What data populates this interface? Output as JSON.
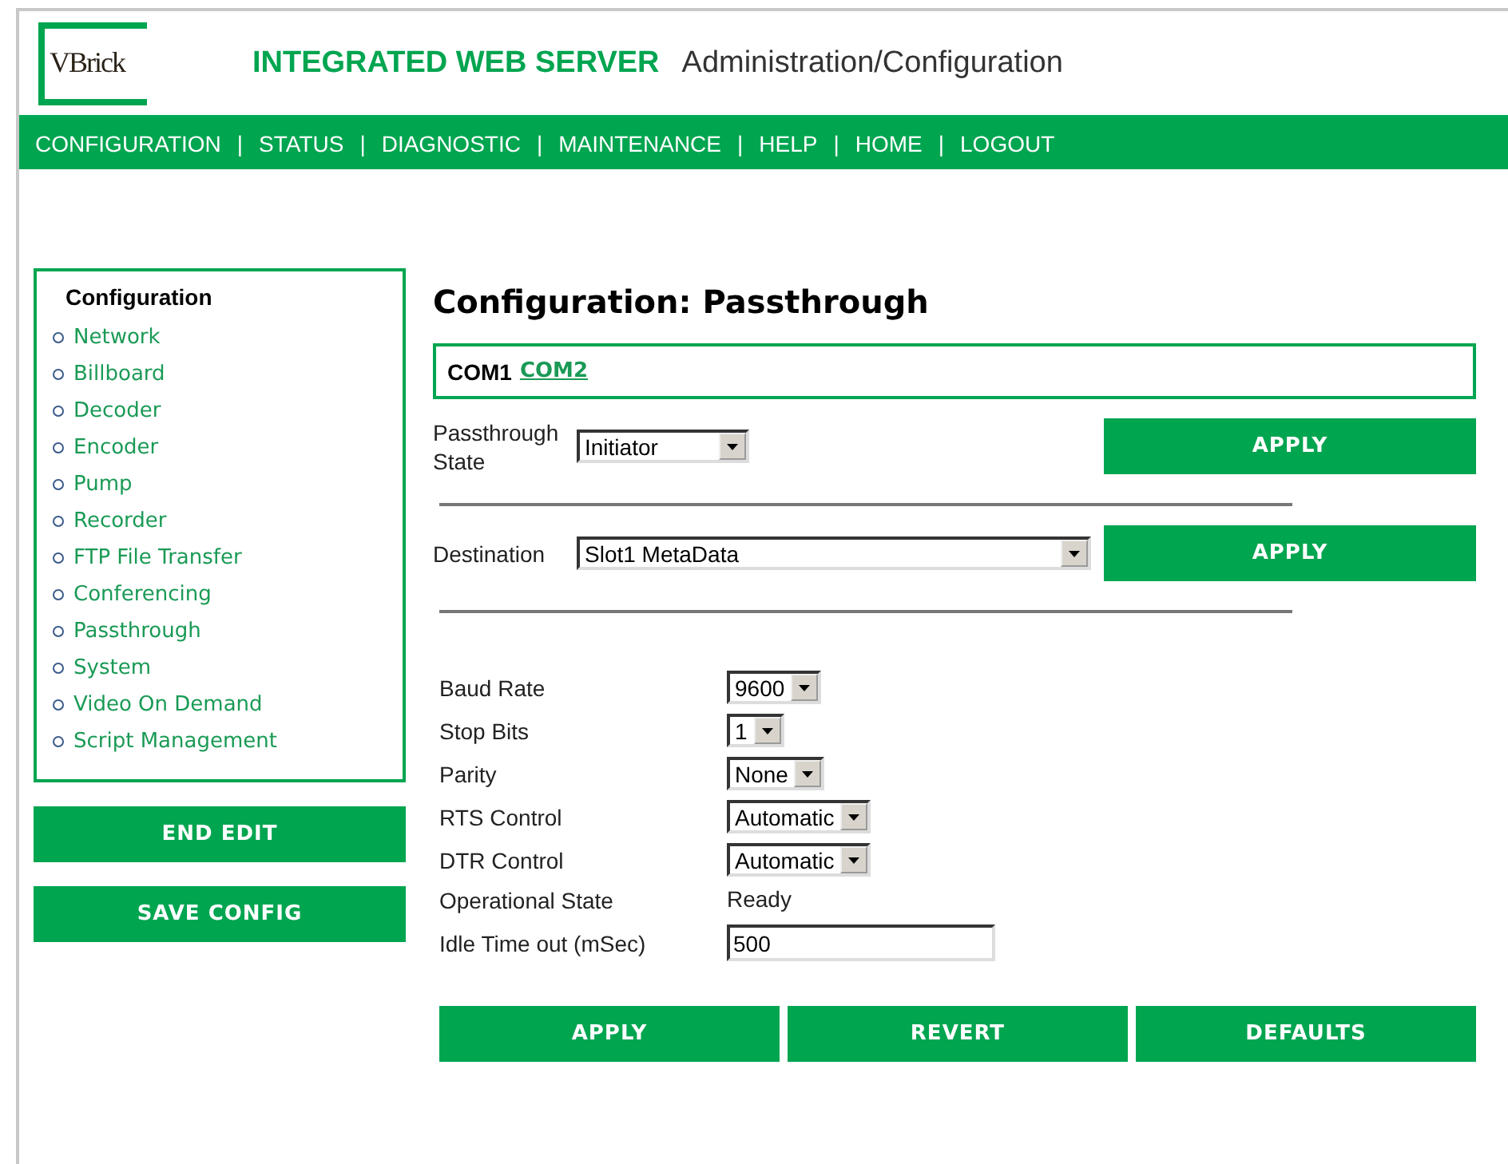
{
  "header": {
    "logo": "VBrick",
    "title": "INTEGRATED WEB SERVER",
    "subtitle": "Administration/Configuration"
  },
  "nav": {
    "separator": "|",
    "items": [
      "CONFIGURATION",
      "STATUS",
      "DIAGNOSTIC",
      "MAINTENANCE",
      "HELP",
      "HOME",
      "LOGOUT"
    ]
  },
  "sidebar": {
    "title": "Configuration",
    "items": [
      "Network",
      "Billboard",
      "Decoder",
      "Encoder",
      "Pump",
      "Recorder",
      "FTP File Transfer",
      "Conferencing",
      "Passthrough",
      "System",
      "Video On Demand",
      "Script Management"
    ],
    "buttons": [
      "END EDIT",
      "SAVE CONFIG"
    ]
  },
  "main": {
    "title": "Configuration: Passthrough",
    "ports": [
      {
        "label": "COM1",
        "selected": true
      },
      {
        "label": "COM2",
        "selected": false
      }
    ],
    "top_rows": [
      {
        "label": "Passthrough State",
        "value": "Initiator",
        "button": "APPLY"
      },
      {
        "label": "Destination",
        "value": "Slot1 MetaData",
        "button": "APPLY"
      }
    ],
    "fields": [
      {
        "kind": "select",
        "label": "Baud Rate",
        "value": "9600"
      },
      {
        "kind": "select",
        "label": "Stop Bits",
        "value": "1"
      },
      {
        "kind": "select",
        "label": "Parity",
        "value": "None"
      },
      {
        "kind": "select",
        "label": "RTS Control",
        "value": "Automatic"
      },
      {
        "kind": "select",
        "label": "DTR Control",
        "value": "Automatic"
      },
      {
        "kind": "text",
        "label": "Operational State",
        "value": "Ready"
      },
      {
        "kind": "input",
        "label": "Idle Time out (mSec)",
        "value": "500"
      }
    ],
    "buttons": [
      "APPLY",
      "REVERT",
      "DEFAULTS"
    ]
  }
}
